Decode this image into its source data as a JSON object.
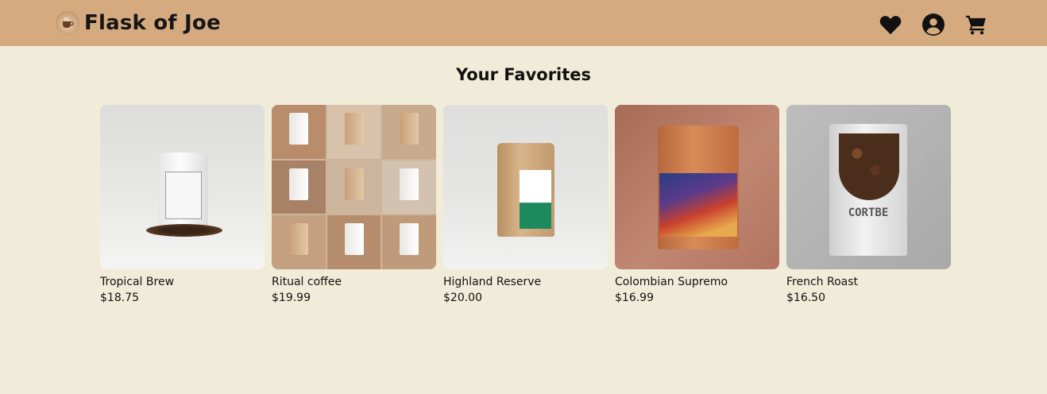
{
  "header": {
    "brand": "Flask of Joe",
    "icons": [
      "heart-icon",
      "user-icon",
      "cart-icon"
    ]
  },
  "page": {
    "title": "Your Favorites"
  },
  "products": [
    {
      "name": "Tropical Brew",
      "price": "$18.75"
    },
    {
      "name": "Ritual coffee",
      "price": "$19.99"
    },
    {
      "name": "Highland Reserve",
      "price": "$20.00"
    },
    {
      "name": "Colombian Supremo",
      "price": "$16.99"
    },
    {
      "name": "French Roast",
      "price": "$16.50"
    }
  ],
  "product_art": {
    "french_roast_bag_text": "CORTBE"
  },
  "colors": {
    "header": "#d6aa7f",
    "background": "#f1ecd9",
    "text": "#111111"
  }
}
